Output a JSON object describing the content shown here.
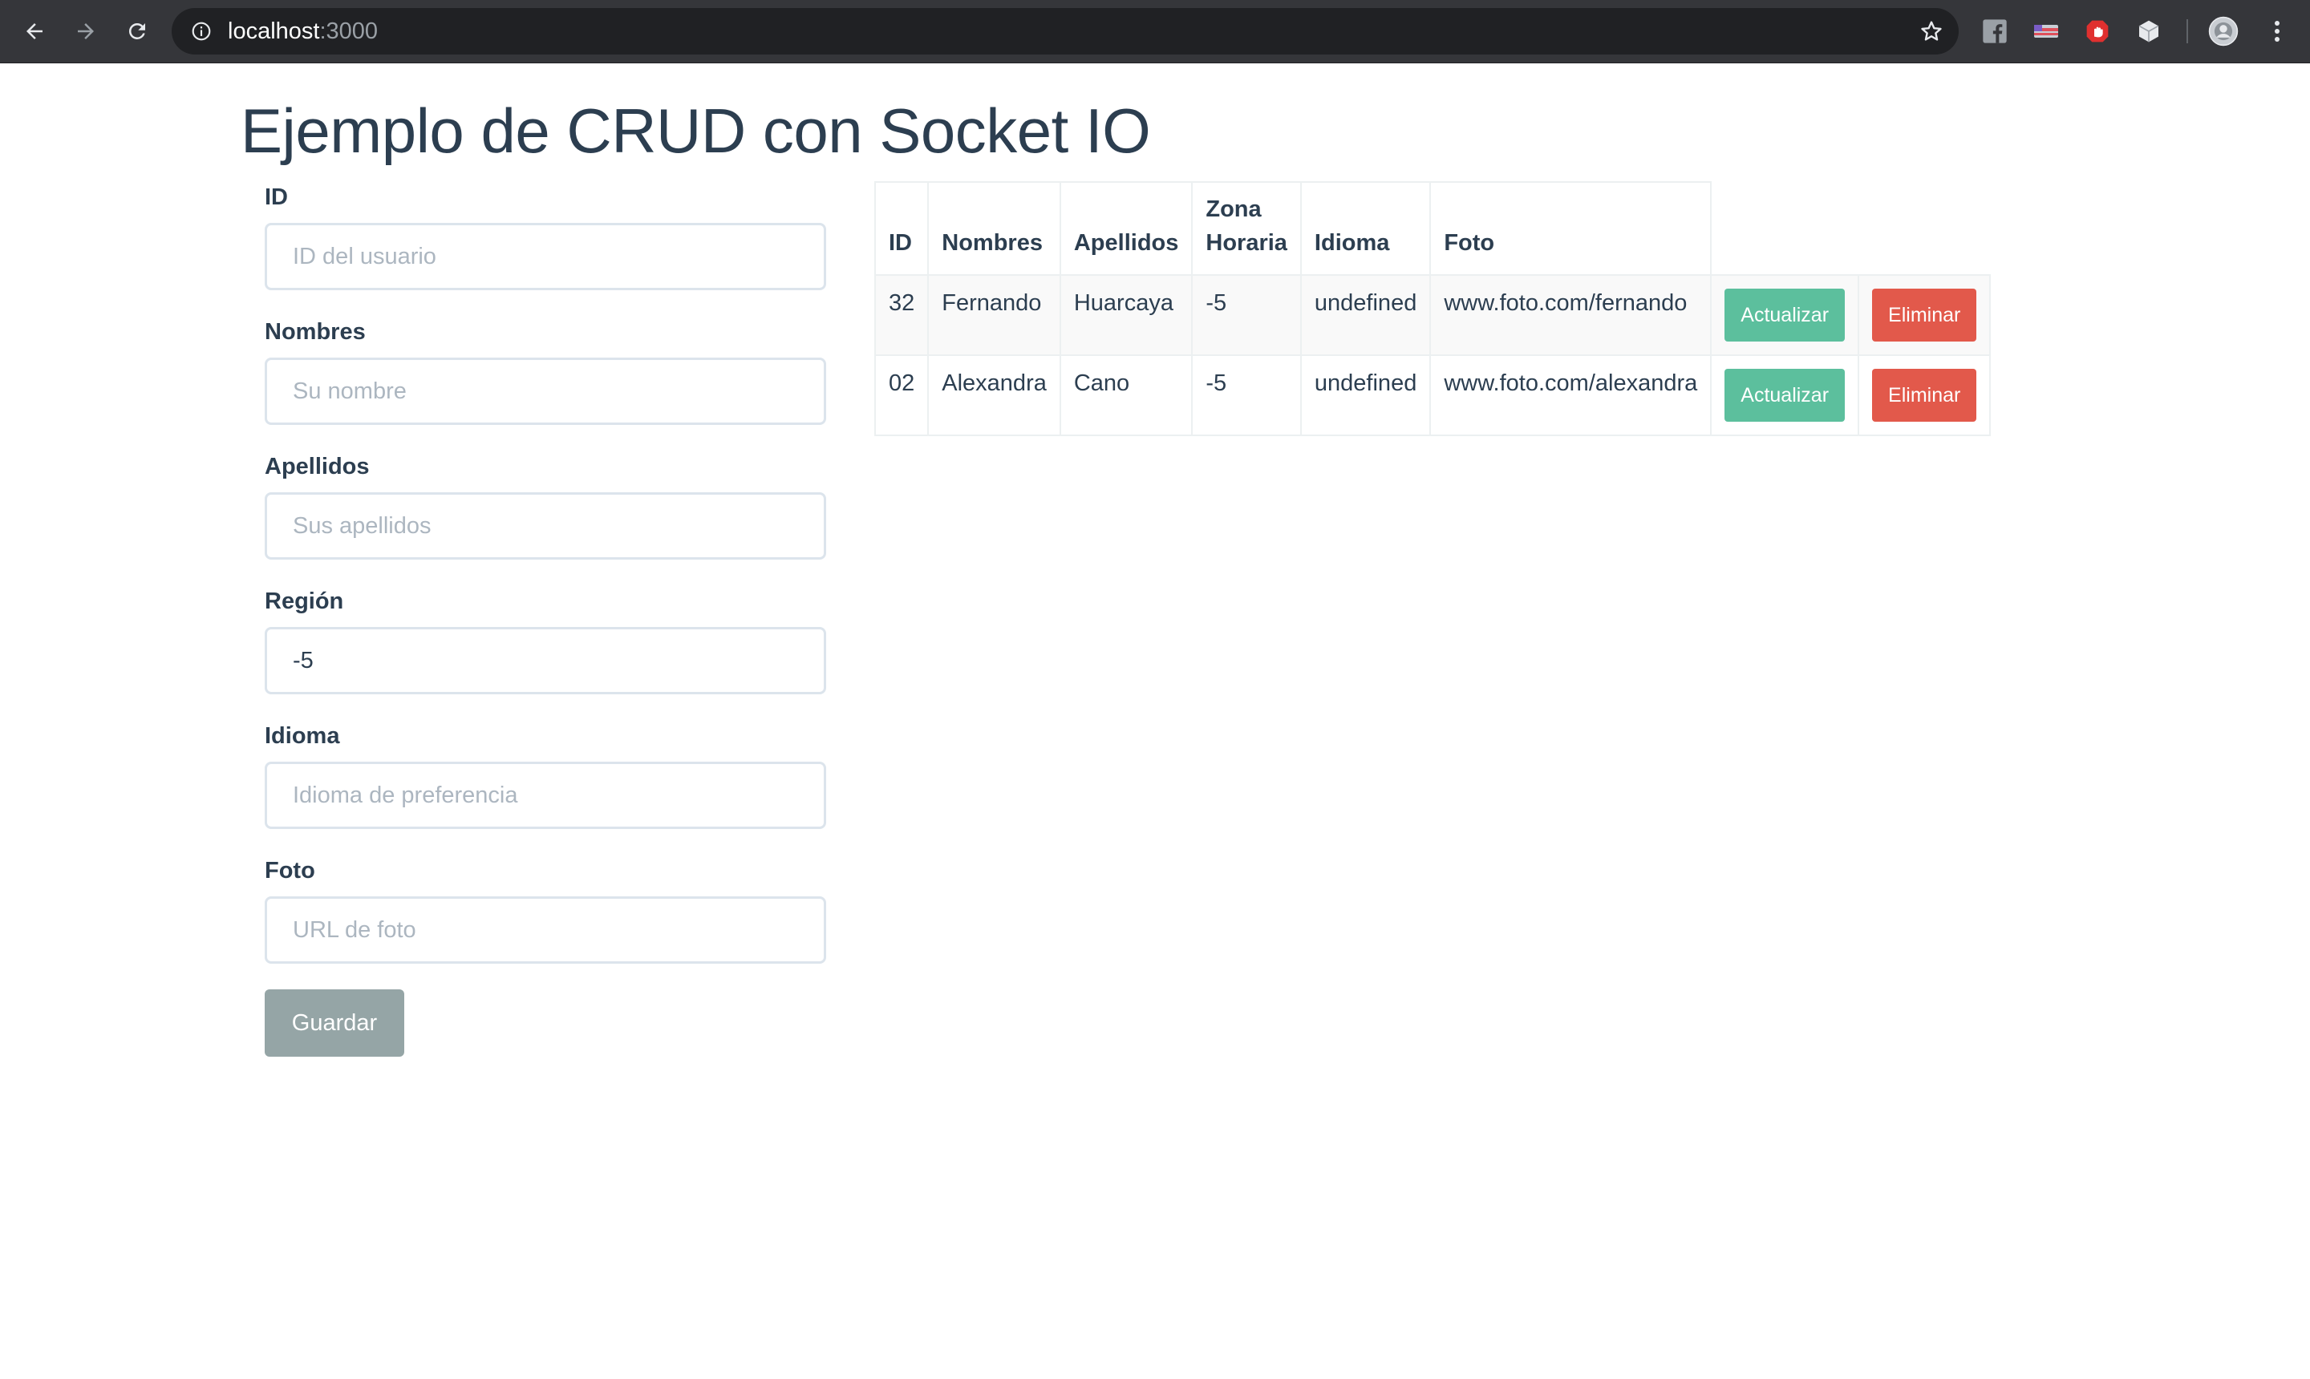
{
  "browser": {
    "url_host": "localhost",
    "url_port": ":3000",
    "icons": {
      "back": "arrow-left",
      "forward": "arrow-right",
      "reload": "reload",
      "site_info": "info-circle",
      "bookmark": "star-outline",
      "extensions": [
        "facebook",
        "flag",
        "hand-stop",
        "cube"
      ],
      "profile": "avatar",
      "menu": "kebab-menu"
    }
  },
  "page": {
    "title": "Ejemplo de CRUD con Socket IO"
  },
  "form": {
    "id": {
      "label": "ID",
      "placeholder": "ID del usuario",
      "value": ""
    },
    "nombres": {
      "label": "Nombres",
      "placeholder": "Su nombre",
      "value": ""
    },
    "apellidos": {
      "label": "Apellidos",
      "placeholder": "Sus apellidos",
      "value": ""
    },
    "region": {
      "label": "Región",
      "placeholder": "",
      "value": "-5"
    },
    "idioma": {
      "label": "Idioma",
      "placeholder": "Idioma de preferencia",
      "value": ""
    },
    "foto": {
      "label": "Foto",
      "placeholder": "URL de foto",
      "value": ""
    },
    "save_label": "Guardar"
  },
  "table": {
    "headers": {
      "id": "ID",
      "nombres": "Nombres",
      "apellidos": "Apellidos",
      "zona_line1": "Zona",
      "zona_line2": "Horaria",
      "idioma": "Idioma",
      "foto": "Foto"
    },
    "rows": [
      {
        "id": "32",
        "nombres": "Fernando",
        "apellidos": "Huarcaya",
        "zona": "-5",
        "idioma": "undefined",
        "foto": "www.foto.com/fernando",
        "update_label": "Actualizar",
        "delete_label": "Eliminar"
      },
      {
        "id": "02",
        "nombres": "Alexandra",
        "apellidos": "Cano",
        "zona": "-5",
        "idioma": "undefined",
        "foto": "www.foto.com/alexandra",
        "update_label": "Actualizar",
        "delete_label": "Eliminar"
      }
    ]
  },
  "colors": {
    "primary_text": "#2c3e50",
    "update_button": "#5cbf9d",
    "delete_button": "#e2594b",
    "save_button": "#95a5a6",
    "chrome_bar": "#35363a"
  }
}
